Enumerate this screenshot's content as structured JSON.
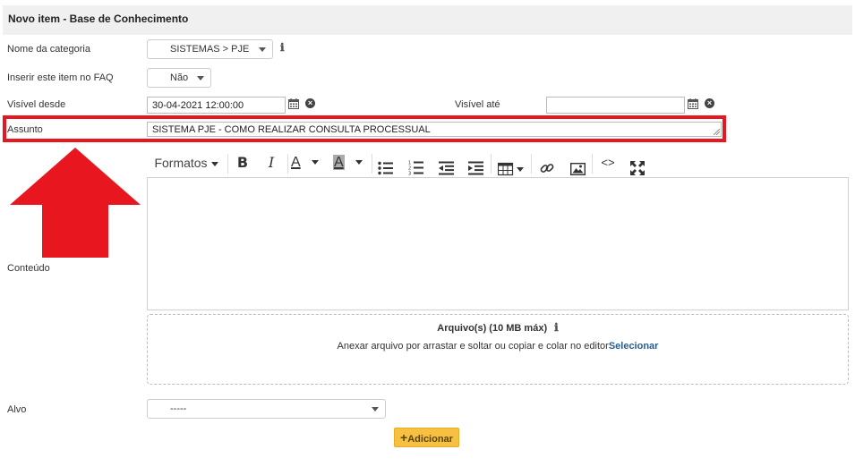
{
  "header": {
    "title": "Novo item - Base de Conhecimento"
  },
  "form": {
    "category": {
      "label": "Nome da categoria",
      "value": "SISTEMAS > PJE"
    },
    "faq": {
      "label": "Inserir este item no FAQ",
      "value": "Não"
    },
    "visible_from": {
      "label": "Visível desde",
      "value": "30-04-2021 12:00:00"
    },
    "visible_to": {
      "label": "Visível até",
      "value": ""
    },
    "subject": {
      "label": "Assunto",
      "value": "SISTEMA PJE - COMO REALIZAR CONSULTA PROCESSUAL"
    },
    "content": {
      "label": "Conteúdo"
    },
    "target": {
      "label": "Alvo",
      "value": "-----"
    }
  },
  "editor_toolbar": {
    "formats_label": "Formatos",
    "bold": "B",
    "italic": "I",
    "font_color": "A",
    "bg_color": "A",
    "code": "<>"
  },
  "attachments": {
    "title": "Arquivo(s) (10 MB máx)",
    "instructions": "Anexar arquivo por arrastar e soltar ou copiar e colar no editor",
    "select_link": "Selecionar"
  },
  "actions": {
    "add_label": "Adicionar",
    "add_icon": "+"
  },
  "colors": {
    "highlight": "#e8161f",
    "add_button": "#f6c142",
    "link": "#2a5d8f"
  }
}
